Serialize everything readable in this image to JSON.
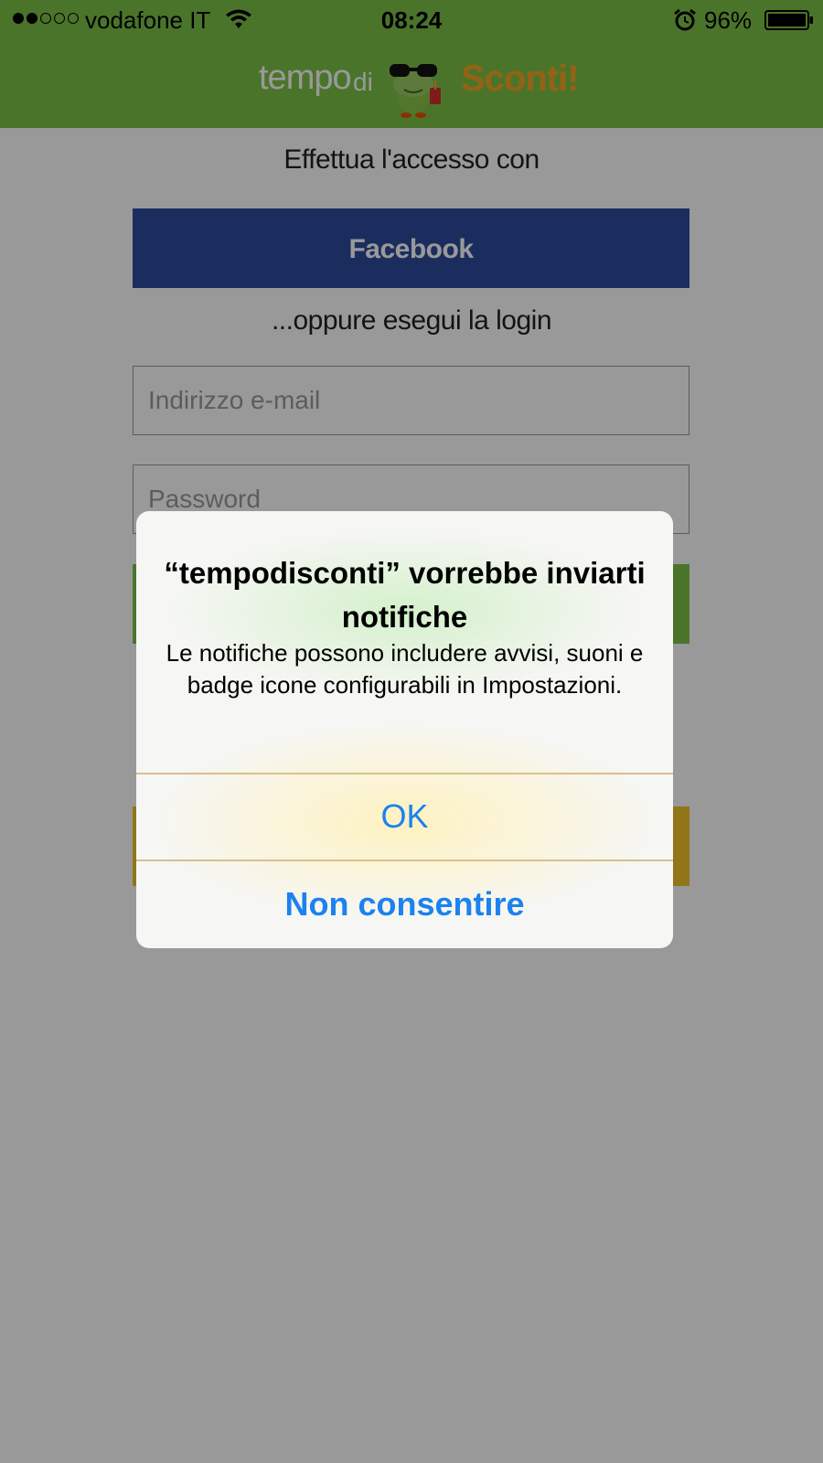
{
  "status_bar": {
    "carrier": "vodafone IT",
    "time": "08:24",
    "battery_percent": "96%",
    "signal_bars_filled": 2,
    "signal_bars_total": 5
  },
  "header": {
    "brand_word_1": "tempo",
    "brand_word_2": "di",
    "brand_word_3": "Sconti!"
  },
  "login": {
    "prompt_top": "Effettua l'accesso con",
    "facebook_label": "Facebook",
    "prompt_mid": "...oppure esegui la login",
    "email_placeholder": "Indirizzo e-mail",
    "password_placeholder": "Password"
  },
  "alert": {
    "title": "“tempodisconti” vorrebbe inviarti notifiche",
    "message": "Le notifiche possono includere avvisi, suoni e badge icone configurabili in Impostazioni.",
    "ok_label": "OK",
    "deny_label": "Non consentire"
  },
  "colors": {
    "header_green": "#7ec249",
    "facebook_blue": "#2d4b9e",
    "button_yellow": "#f5c32a",
    "alert_button_blue": "#1b82f0",
    "brand_orange": "#f5a623"
  },
  "icons": [
    "signal-dots-icon",
    "wifi-icon",
    "alarm-icon",
    "battery-icon",
    "frog-logo-icon"
  ]
}
